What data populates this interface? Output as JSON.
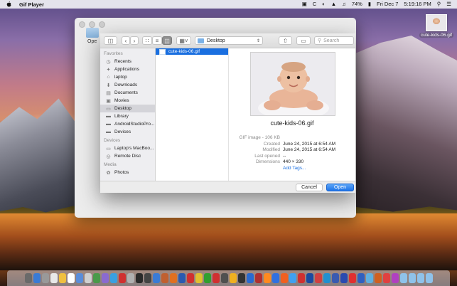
{
  "menubar": {
    "app_name": "Gif Player",
    "status_items": [
      "74%",
      "Fri Dec 7",
      "5:19:16 PM"
    ],
    "input_letter": "C"
  },
  "desktop_file": {
    "label": "cute-kids-06.gif"
  },
  "app_window": {
    "open_label": "Ope"
  },
  "dialog": {
    "toolbar": {
      "location": "Desktop",
      "search_placeholder": "Search"
    },
    "sidebar": {
      "favorites_heading": "Favorites",
      "favorites": [
        {
          "label": "Recents",
          "icon": "clock-icon"
        },
        {
          "label": "Applications",
          "icon": "applications-icon"
        },
        {
          "label": "laptop",
          "icon": "home-icon"
        },
        {
          "label": "Downloads",
          "icon": "downloads-icon"
        },
        {
          "label": "Documents",
          "icon": "documents-icon"
        },
        {
          "label": "Movies",
          "icon": "movies-icon"
        },
        {
          "label": "Desktop",
          "icon": "desktop-icon",
          "selected": true
        },
        {
          "label": "Library",
          "icon": "folder-icon"
        },
        {
          "label": "AndroidStudioPro...",
          "icon": "folder-icon"
        },
        {
          "label": "Devices",
          "icon": "folder-icon"
        }
      ],
      "devices_heading": "Devices",
      "devices": [
        {
          "label": "Laptop's MacBoo...",
          "icon": "laptop-icon"
        },
        {
          "label": "Remote Disc",
          "icon": "disc-icon"
        }
      ],
      "media_heading": "Media",
      "media": [
        {
          "label": "Photos",
          "icon": "photos-icon"
        }
      ]
    },
    "file_list": [
      {
        "name": "cute-kids-06.gif",
        "selected": true
      }
    ],
    "preview": {
      "file_name": "cute-kids-06.gif",
      "kind_size": "GIF image - 106 KB",
      "created_label": "Created",
      "created": "June 24, 2015 at 6:54 AM",
      "modified_label": "Modified",
      "modified": "June 24, 2015 at 6:54 AM",
      "last_opened_label": "Last opened",
      "last_opened": "--",
      "dimensions_label": "Dimensions",
      "dimensions": "440 × 330",
      "add_tags": "Add Tags..."
    },
    "buttons": {
      "cancel": "Cancel",
      "open": "Open"
    }
  },
  "dock": {
    "colors": [
      "#6a6a6a",
      "#3a7bd5",
      "#999999",
      "#e8e8e8",
      "#f0c040",
      "#ffffff",
      "#5b8dd9",
      "#d0d0d0",
      "#4a9a4a",
      "#8a6ad0",
      "#3aa0e0",
      "#d03030",
      "#b0b0b0",
      "#2a2a2a",
      "#444444",
      "#3a7bd5",
      "#c06030",
      "#e07020",
      "#2a5ab0",
      "#d03030",
      "#e0c030",
      "#30a030",
      "#d03030",
      "#505050",
      "#f0b020",
      "#333333",
      "#2a6ad0",
      "#b03030",
      "#ff8a20",
      "#3070e0",
      "#f06020",
      "#40a0f0",
      "#d03030",
      "#1a4aa0",
      "#d04040",
      "#2090d0",
      "#3a5ab0",
      "#2a4ab0",
      "#e03030",
      "#3060c0",
      "#60b0e0",
      "#d06020",
      "#e04040",
      "#b040c0",
      "#8fc2ea",
      "#8fc2ea",
      "#8fc2ea",
      "#8fc2ea"
    ]
  }
}
